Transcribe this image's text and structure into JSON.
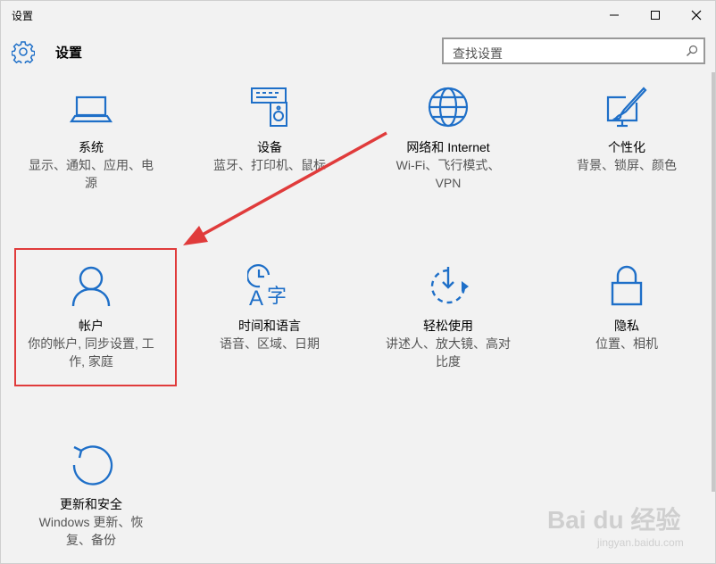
{
  "window": {
    "title": "设置",
    "minimize_icon": "minimize-icon",
    "maximize_icon": "maximize-icon",
    "close_icon": "close-icon"
  },
  "header": {
    "icon": "gear-icon",
    "title": "设置"
  },
  "search": {
    "placeholder": "查找设置",
    "icon": "search-icon"
  },
  "tiles": [
    {
      "id": "system",
      "icon": "laptop-icon",
      "name": "系统",
      "desc": "显示、通知、应用、电源"
    },
    {
      "id": "devices",
      "icon": "devices-icon",
      "name": "设备",
      "desc": "蓝牙、打印机、鼠标"
    },
    {
      "id": "network",
      "icon": "globe-icon",
      "name": "网络和 Internet",
      "desc": "Wi-Fi、飞行模式、VPN"
    },
    {
      "id": "personalization",
      "icon": "paint-icon",
      "name": "个性化",
      "desc": "背景、锁屏、颜色"
    },
    {
      "id": "accounts",
      "icon": "person-icon",
      "name": "帐户",
      "desc": "你的帐户, 同步设置, 工作, 家庭"
    },
    {
      "id": "time-language",
      "icon": "time-language-icon",
      "name": "时间和语言",
      "desc": "语音、区域、日期"
    },
    {
      "id": "ease-of-access",
      "icon": "ease-of-access-icon",
      "name": "轻松使用",
      "desc": "讲述人、放大镜、高对比度"
    },
    {
      "id": "privacy",
      "icon": "lock-icon",
      "name": "隐私",
      "desc": "位置、相机"
    },
    {
      "id": "update-security",
      "icon": "refresh-icon",
      "name": "更新和安全",
      "desc": "Windows 更新、恢复、备份"
    }
  ],
  "annotation": {
    "color": "#e03b3b",
    "target": "accounts"
  },
  "watermark": {
    "logo": "Bai du 经验",
    "url": "jingyan.baidu.com"
  },
  "colors": {
    "accent": "#1e6fc8",
    "background": "#f2f2f2"
  }
}
